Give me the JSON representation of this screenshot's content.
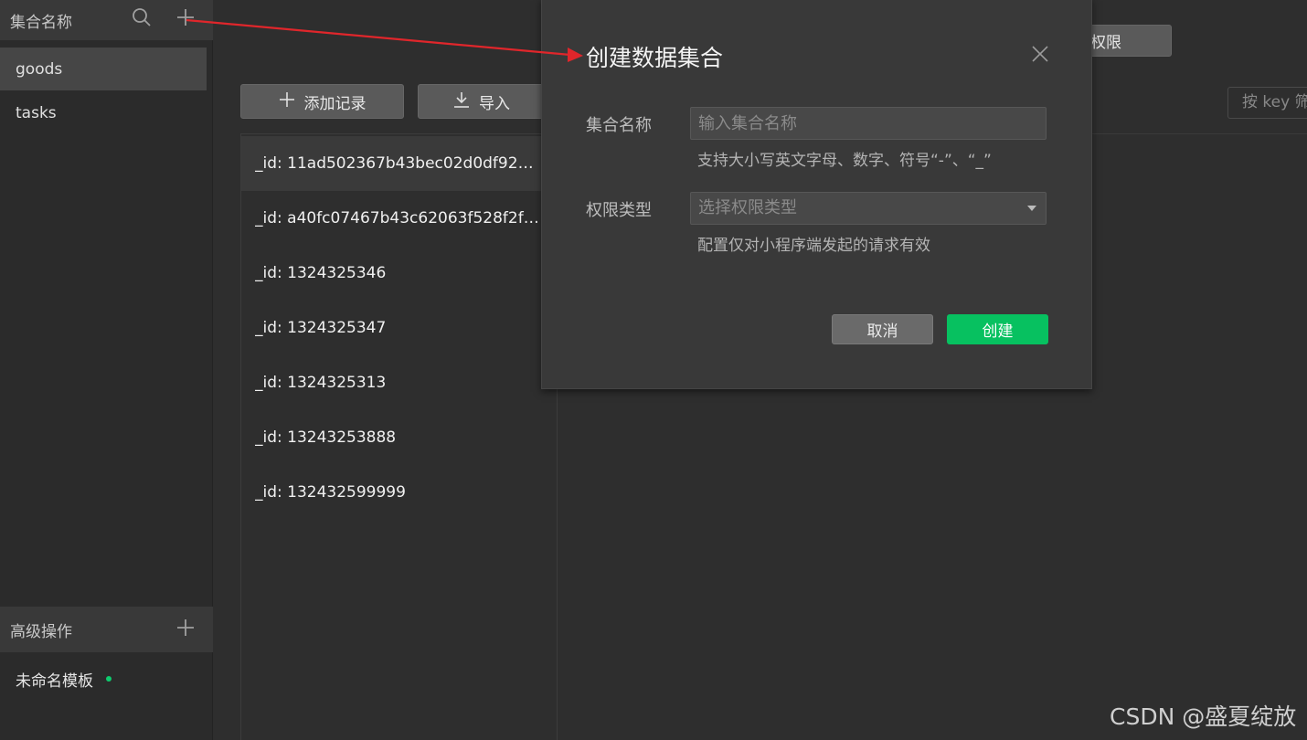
{
  "sidebar": {
    "header_title": "集合名称",
    "search_icon": "search-icon",
    "add_icon": "plus-icon",
    "collections": [
      {
        "label": "goods",
        "active": true
      },
      {
        "label": "tasks",
        "active": false
      }
    ],
    "advanced_title": "高级操作",
    "templates": [
      {
        "label": "未命名模板"
      }
    ]
  },
  "toolbar": {
    "add_record_label": "添加记录",
    "import_label": "导入",
    "permission_label": "权限",
    "search_placeholder": "按 key 筛"
  },
  "records": [
    "_id: 11ad502367b43bec02d0df924...",
    "_id: a40fc07467b43c62063f528f2f9...",
    "_id: 1324325346",
    "_id: 1324325347",
    "_id: 1324325313",
    "_id: 13243253888",
    "_id: 132432599999"
  ],
  "dialog": {
    "title": "创建数据集合",
    "name_label": "集合名称",
    "name_placeholder": "输入集合名称",
    "name_hint": "支持大小写英文字母、数字、符号“-”、“_”",
    "perm_label": "权限类型",
    "perm_placeholder": "选择权限类型",
    "perm_hint": "配置仅对小程序端发起的请求有效",
    "cancel_label": "取消",
    "create_label": "创建"
  },
  "watermark": "CSDN @盛夏绽放",
  "colors": {
    "accent_green": "#07c160",
    "arrow_red": "#e0262b"
  }
}
